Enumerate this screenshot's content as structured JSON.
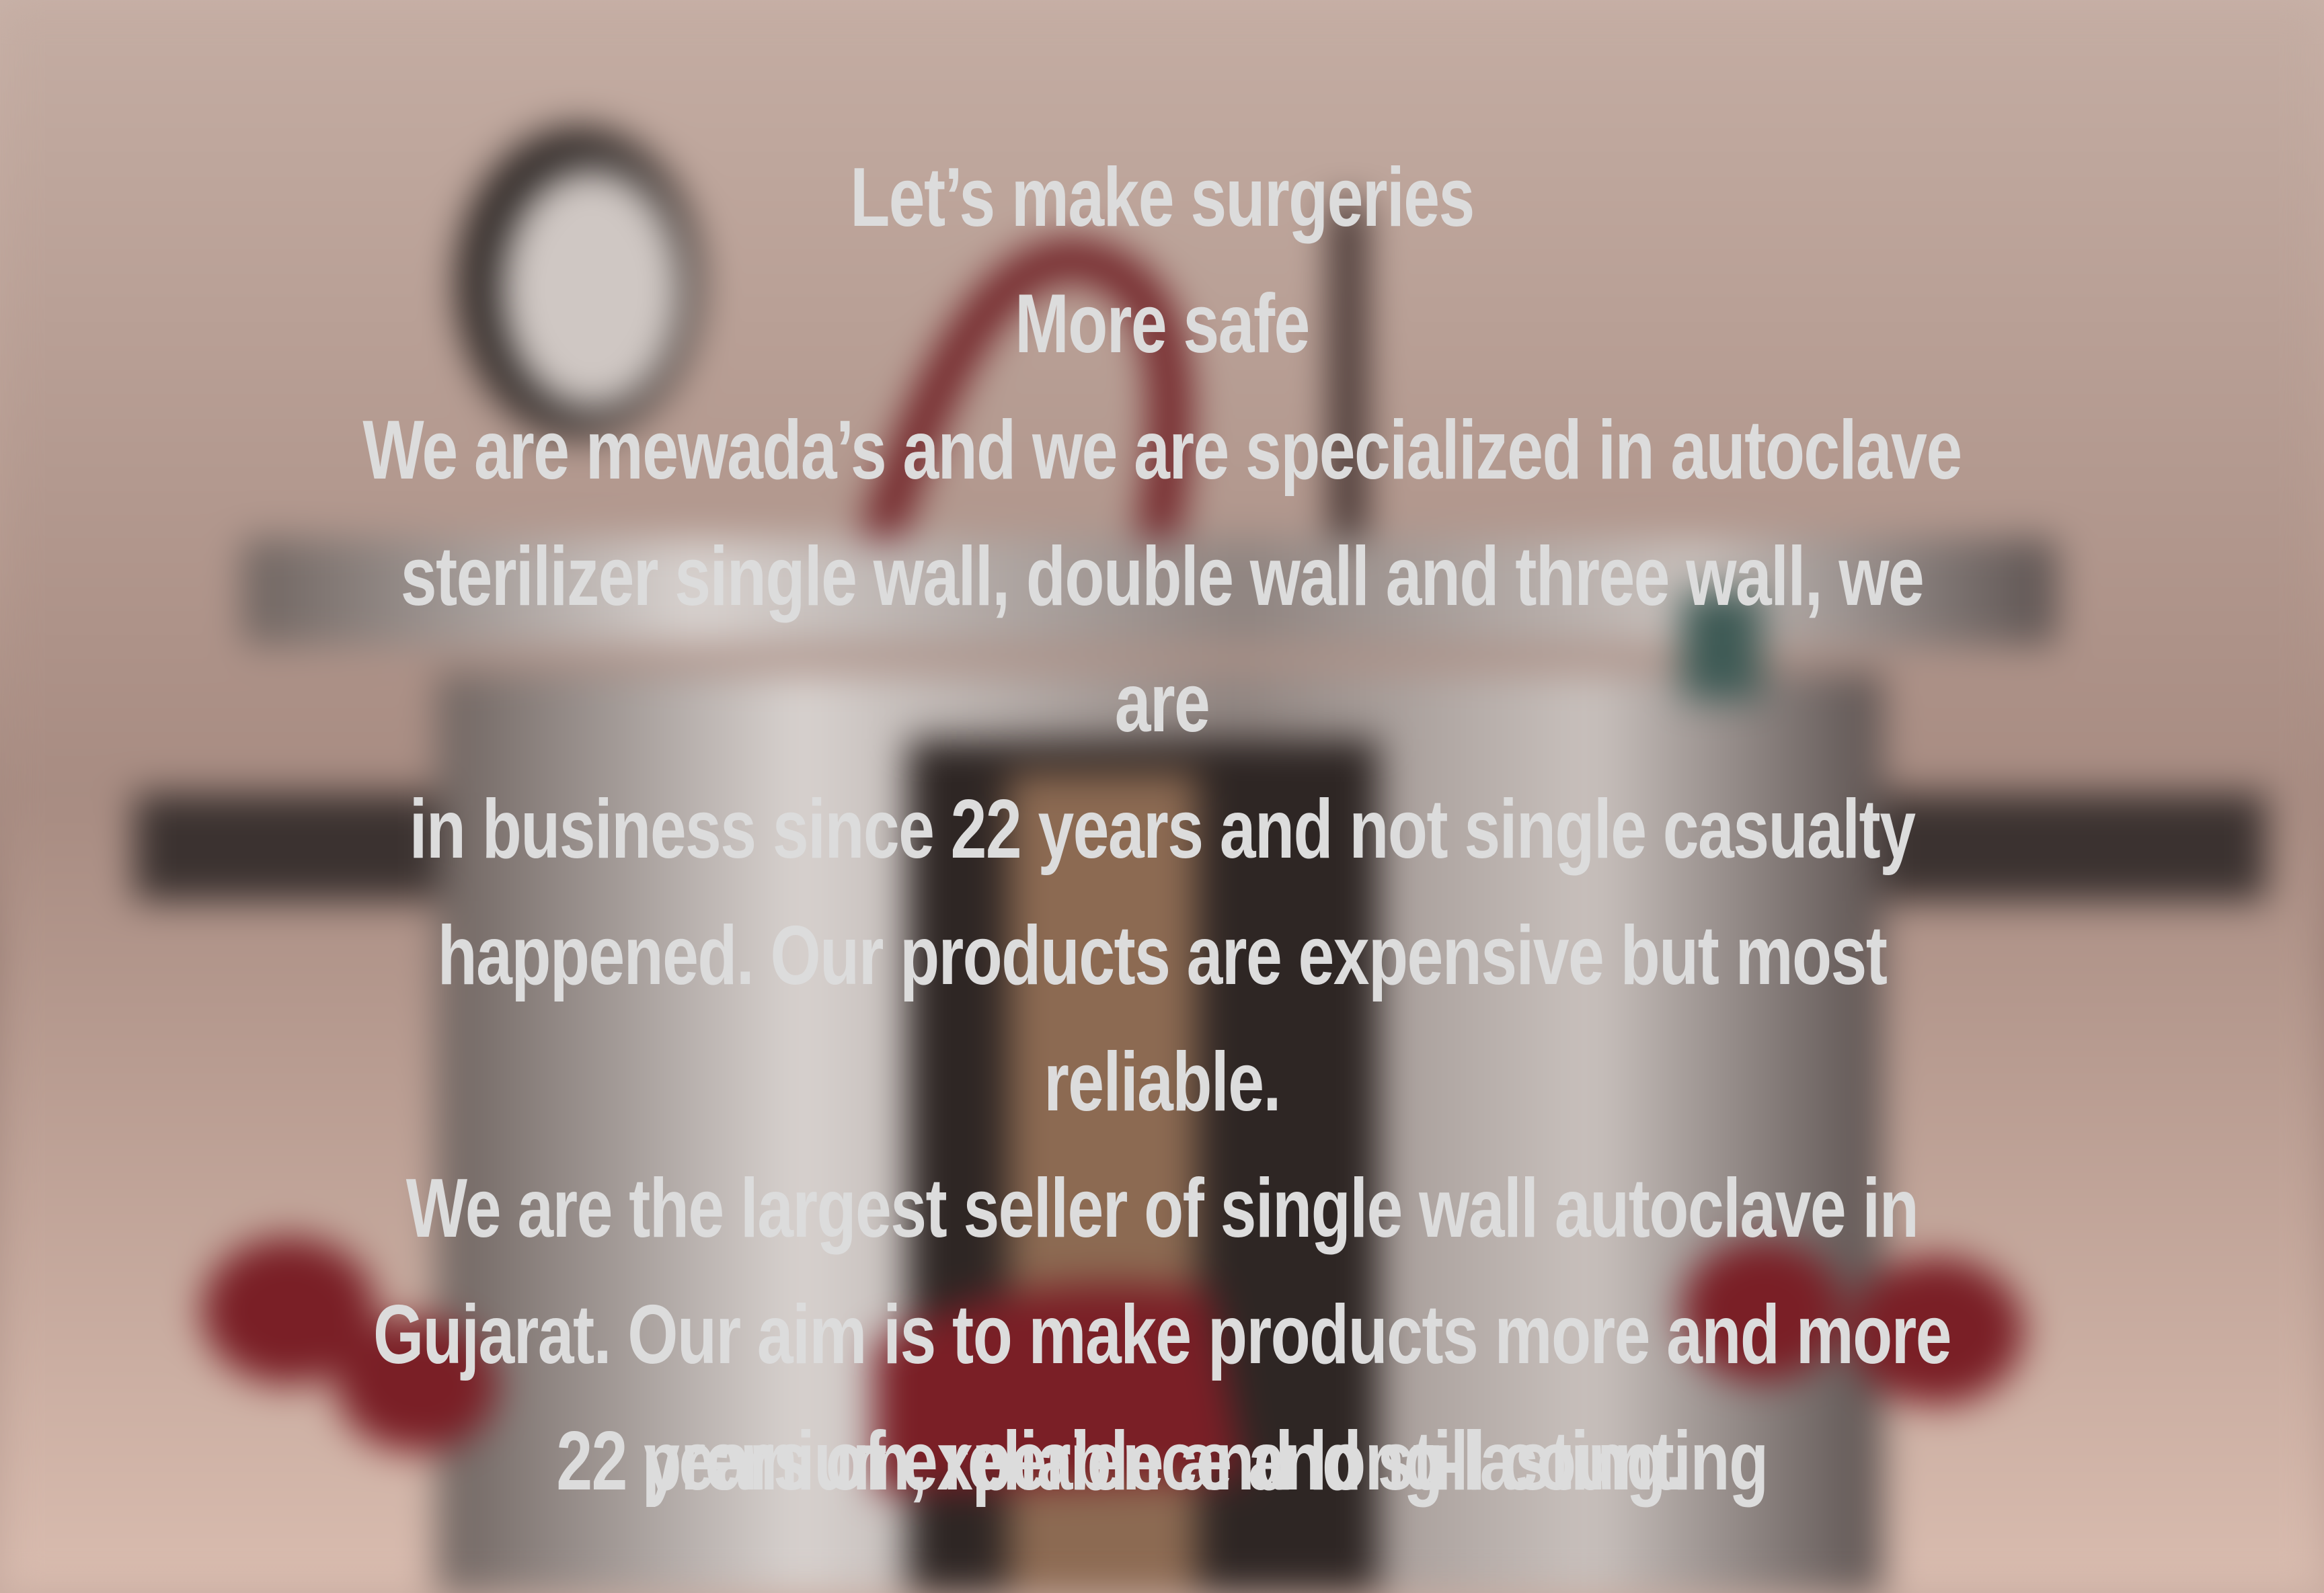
{
  "hero": {
    "title_line_1": "Let’s make surgeries",
    "title_line_2": "More safe",
    "body_lines": [
      "We are mewada’s and we are specialized in autoclave",
      "sterilizer single wall, double wall and three wall, we are",
      "in business since 22 years and not single casualty",
      "happened. Our products are expensive but most reliable.",
      "We are the largest seller of single wall autoclave in",
      "Gujarat. Our aim is to make products more and more",
      "premium, reliable and long-lasting."
    ],
    "closing": "22 years of experience and still counting"
  },
  "colors": {
    "text": "#dcdcdc",
    "accent_red": "#7a1f26"
  },
  "background_image": "blurred-autoclave-sterilizer-photo"
}
